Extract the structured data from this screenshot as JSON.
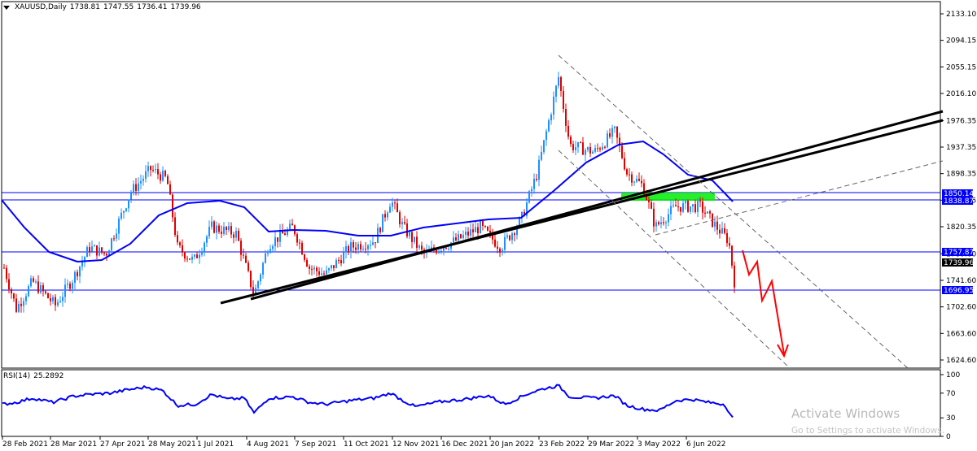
{
  "header": {
    "symbol": "XAUUSD,Daily",
    "open": "1738.81",
    "high": "1747.55",
    "low": "1736.41",
    "close": "1739.96"
  },
  "rsi": {
    "label": "RSI(14)",
    "value": "25.2892",
    "scale": [
      "100",
      "70",
      "30",
      "0"
    ]
  },
  "price_scale": [
    "2133.10",
    "2094.15",
    "2055.15",
    "2016.10",
    "1976.35",
    "1937.35",
    "1898.35",
    "1859.35",
    "1820.35",
    "1780.60",
    "1741.60",
    "1702.60",
    "1663.60",
    "1624.60"
  ],
  "level_labels": [
    {
      "value": "1850.14",
      "color": "#0000ff"
    },
    {
      "value": "1838.87",
      "color": "#0000ff"
    },
    {
      "value": "1757.87",
      "color": "#0000ff"
    },
    {
      "value": "1739.96",
      "color": "#000000"
    },
    {
      "value": "1696.95",
      "color": "#0000ff"
    }
  ],
  "dates": [
    "28 Feb 2021",
    "28 Mar 2021",
    "27 Apr 2021",
    "28 May 2021",
    "1 Jul 2021",
    "4 Aug 2021",
    "7 Sep 2021",
    "11 Oct 2021",
    "12 Nov 2021",
    "16 Dec 2021",
    "20 Jan 2022",
    "23 Feb 2022",
    "29 Mar 2022",
    "3 May 2022",
    "6 Jun 2022"
  ],
  "watermark": {
    "title": "Activate Windows",
    "subtitle": "Go to Settings to activate Windows."
  },
  "colors": {
    "bull": "#1e90ff",
    "bear": "#e00000",
    "ma": "#0000ff",
    "trend": "#000000",
    "zone": "#00ee00",
    "arrow": "#ff0000"
  }
}
